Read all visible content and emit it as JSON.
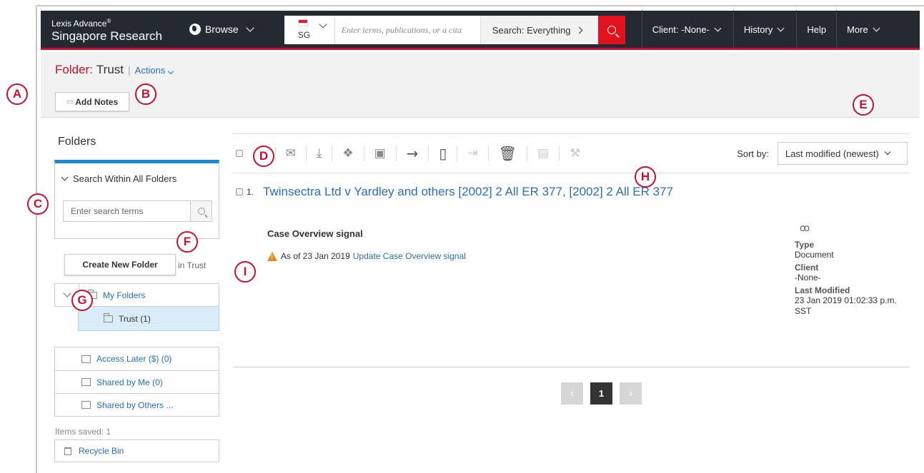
{
  "nav": {
    "brand_small": "Lexis Advance",
    "brand_reg": "®",
    "brand_big": "Singapore Research",
    "browse": "Browse",
    "country": "SG",
    "search_placeholder": "Enter terms, publications, or a cita",
    "scope": "Search: Everything",
    "client": "Client: -None-",
    "history": "History",
    "help": "Help",
    "more": "More"
  },
  "header": {
    "folder_label": "Folder:",
    "folder_name": "Trust",
    "separator": "|",
    "actions": "Actions",
    "add_notes": "Add Notes"
  },
  "sidebar": {
    "title": "Folders",
    "search_within": "Search Within All Folders",
    "search_placeholder": "Enter search terms",
    "create_folder": "Create New Folder",
    "in_trust": "in Trust",
    "my_folders": "My Folders",
    "trust_folder": "Trust (1)",
    "access_later": "Access Later ($) (0)",
    "shared_by_me": "Shared by Me (0)",
    "shared_by_others": "Shared by Others ...",
    "items_saved": "Items saved: 1",
    "recycle_bin": "Recycle Bin"
  },
  "toolbar": {
    "sort_label": "Sort by:",
    "sort_value": "Last modified (newest)"
  },
  "result": {
    "number": "1.",
    "title": "Twinsectra Ltd v Yardley and others [2002] 2 All ER 377, [2002] 2 All ER 377",
    "signal_heading": "Case Overview signal",
    "as_of": "As of 23 Jan 2019",
    "update_link": "Update Case Overview signal",
    "type_label": "Type",
    "type_value": "Document",
    "client_label": "Client",
    "client_value": "-None-",
    "modified_label": "Last Modified",
    "modified_value": "23 Jan 2019   01:02:33 p.m. SST"
  },
  "pager": {
    "current_page": "1",
    "prev": "‹",
    "next": "›"
  },
  "callouts": {
    "a": "A",
    "b": "B",
    "c": "C",
    "d": "D",
    "e": "E",
    "f": "F",
    "g": "G",
    "h": "H",
    "i": "I"
  },
  "colors": {
    "nav_bg": "#242a31",
    "accent_red": "#c8102e",
    "link_blue": "#2a6ebb",
    "selected_folder_bg": "#d9ecf7",
    "warning_orange": "#e7880f"
  },
  "icons": [
    "globe-icon",
    "search-icon",
    "email-icon",
    "download-icon",
    "dropbox-icon",
    "export-icon",
    "arrow-right-icon",
    "copy-icon",
    "move-icon",
    "delete-icon",
    "share-icon",
    "wrench-icon",
    "glasses-icon",
    "warning-icon",
    "folder-icon",
    "recycle-bin-icon"
  ]
}
